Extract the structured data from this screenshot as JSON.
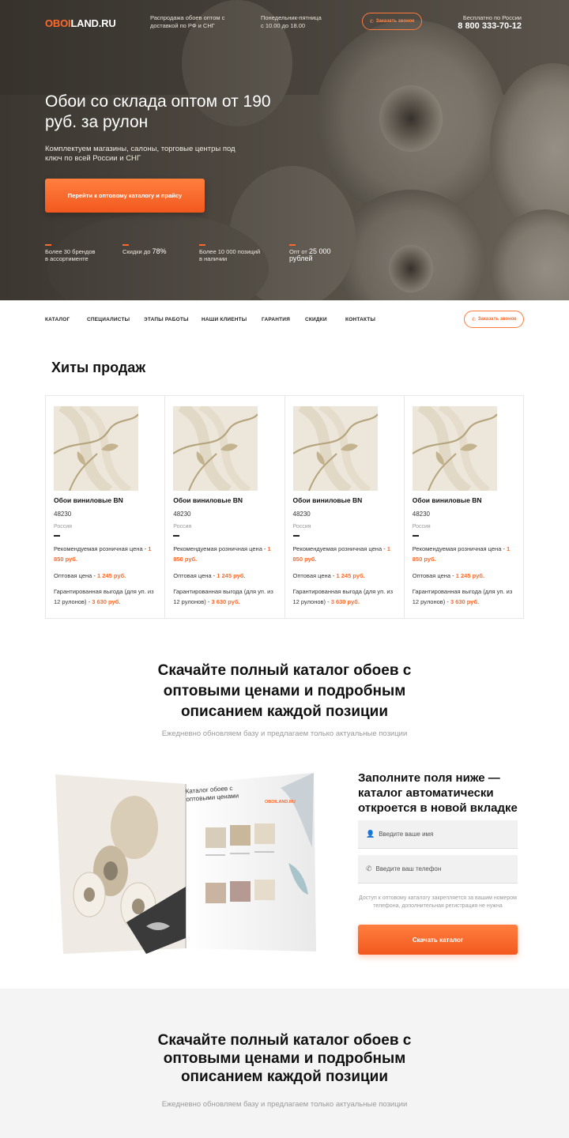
{
  "header": {
    "logo_part1": "OBOI",
    "logo_part2": "LAND.RU",
    "tagline": "Распродажа обоев оптом с доставкой по РФ и СНГ",
    "hours": "Понедельник-пятница с 10.00 до 18.00",
    "callback_label": "Заказать звонок",
    "phone_label": "Бесплатно по России",
    "phone": "8 800 333-70-12"
  },
  "hero": {
    "title": "Обои со склада оптом от 190 руб. за рулон",
    "subtitle": "Комплектуем магазины, салоны, торговые центры под ключ по всей России и СНГ",
    "cta_label": "Перейти к оптовому каталогу и прайсу",
    "stats": [
      {
        "pre": "Более 30 брендов",
        "post": "в ассортименте"
      },
      {
        "pre": "Скидки до ",
        "hl": "78%"
      },
      {
        "pre": "Более 10 000 позиций",
        "post": "в наличии"
      },
      {
        "pre": "Опт от ",
        "hl": "25 000",
        "post": "рублей"
      }
    ]
  },
  "nav": {
    "items": [
      "КАТАЛОГ",
      "СПЕЦИАЛИСТЫ",
      "ЭТАПЫ РАБОТЫ",
      "НАШИ КЛИЕНТЫ",
      "ГАРАНТИЯ",
      "СКИДКИ",
      "КОНТАКТЫ"
    ],
    "callback_label": "Заказать звонок"
  },
  "hits": {
    "title": "Хиты продаж",
    "products": [
      {
        "name": "Обои виниловые BN",
        "code": "48230",
        "country": "Россия",
        "retail_label": "Рекомендуемая розничная цена - ",
        "retail_price": "1 850 руб.",
        "wholesale_label": "Оптовая цена - ",
        "wholesale_price": "1 245 руб.",
        "benefit_label": "Гарантированная выгода (для уп. из 12 рулонов) - ",
        "benefit_value": "3 630 руб."
      },
      {
        "name": "Обои виниловые BN",
        "code": "48230",
        "country": "Россия",
        "retail_label": "Рекомендуемая розничная цена - ",
        "retail_price": "1 850 руб.",
        "wholesale_label": "Оптовая цена - ",
        "wholesale_price": "1 245 руб.",
        "benefit_label": "Гарантированная выгода (для уп. из 12 рулонов) - ",
        "benefit_value": "3 630 руб."
      },
      {
        "name": "Обои виниловые BN",
        "code": "48230",
        "country": "Россия",
        "retail_label": "Рекомендуемая розничная цена - ",
        "retail_price": "1 850 руб.",
        "wholesale_label": "Оптовая цена - ",
        "wholesale_price": "1 245 руб.",
        "benefit_label": "Гарантированная выгода (для уп. из 12 рулонов) - ",
        "benefit_value": "3 630 руб."
      },
      {
        "name": "Обои виниловые BN",
        "code": "48230",
        "country": "Россия",
        "retail_label": "Рекомендуемая розничная цена - ",
        "retail_price": "1 850 руб.",
        "wholesale_label": "Оптовая цена - ",
        "wholesale_price": "1 245 руб.",
        "benefit_label": "Гарантированная выгода (для уп. из 12 рулонов) - ",
        "benefit_value": "3 630 руб."
      }
    ]
  },
  "catalog": {
    "title": "Скачайте полный каталог обоев с оптовыми ценами и подробным описанием каждой позиции",
    "subtitle": "Ежедневно обновляем базу и предлагаем только актуальные позиции",
    "magazine_heading": "Каталог обоев с оптовыми ценами",
    "magazine_logo": "OBOILAND.RU",
    "form_title": "Заполните поля ниже — каталог автоматически откроется в новой вкладке",
    "name_placeholder": "Введите ваше имя",
    "phone_placeholder": "Введите ваш телефон",
    "note": "Доступ к оптовому каталогу закрепляется за вашим номером телефона, дополнительная регистрация не нужна",
    "button_label": "Скачать каталог"
  },
  "catalog2": {
    "title": "Скачайте полный каталог обоев с оптовыми ценами и подробным описанием каждой позиции",
    "subtitle": "Ежедневно обновляем базу и предлагаем только актуальные позиции"
  },
  "colors": {
    "accent": "#ff6a2a",
    "hero_bg": "#6d6558",
    "grey_section": "#f4f4f4"
  }
}
